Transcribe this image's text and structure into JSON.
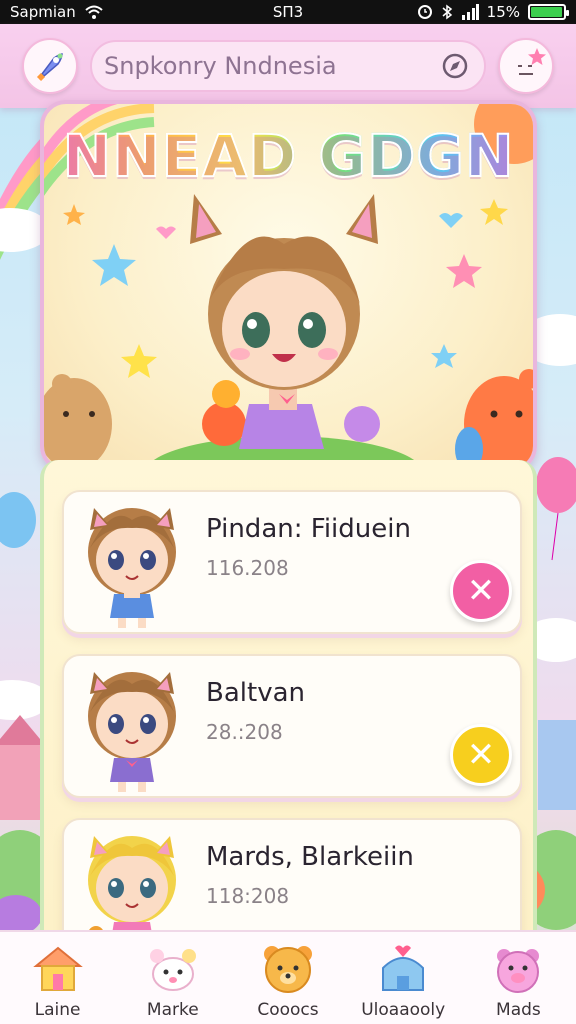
{
  "status_bar": {
    "carrier": "Sapmian",
    "time": "SΠ3",
    "battery": "15%",
    "battery_level": 0.9
  },
  "header": {
    "search_text": "Snpkonry Nndnesia",
    "left_icon": "rocket-icon",
    "search_icon": "compass-icon",
    "right_icon": "face-star-icon"
  },
  "hero": {
    "title": "NNEAD GDGN"
  },
  "list": {
    "items": [
      {
        "name": "Pindan: Fiiduein",
        "meta": "116.208",
        "action_color": "#f25fa4",
        "action_icon": "close-icon"
      },
      {
        "name": "Baltvan",
        "meta": "28.:208",
        "action_color": "#f7cf1e",
        "action_icon": "close-icon"
      },
      {
        "name": "Mards, Blarkeiin",
        "meta": "118:208",
        "action_color": "#f25fa4",
        "action_icon": "close-icon"
      }
    ]
  },
  "nav": {
    "items": [
      {
        "label": "Laine",
        "icon": "house-icon"
      },
      {
        "label": "Marke",
        "icon": "bunny-icon"
      },
      {
        "label": "Cooocs",
        "icon": "bear-icon"
      },
      {
        "label": "Uloaaooly",
        "icon": "home-heart-icon"
      },
      {
        "label": "Mads",
        "icon": "pig-icon"
      }
    ]
  }
}
